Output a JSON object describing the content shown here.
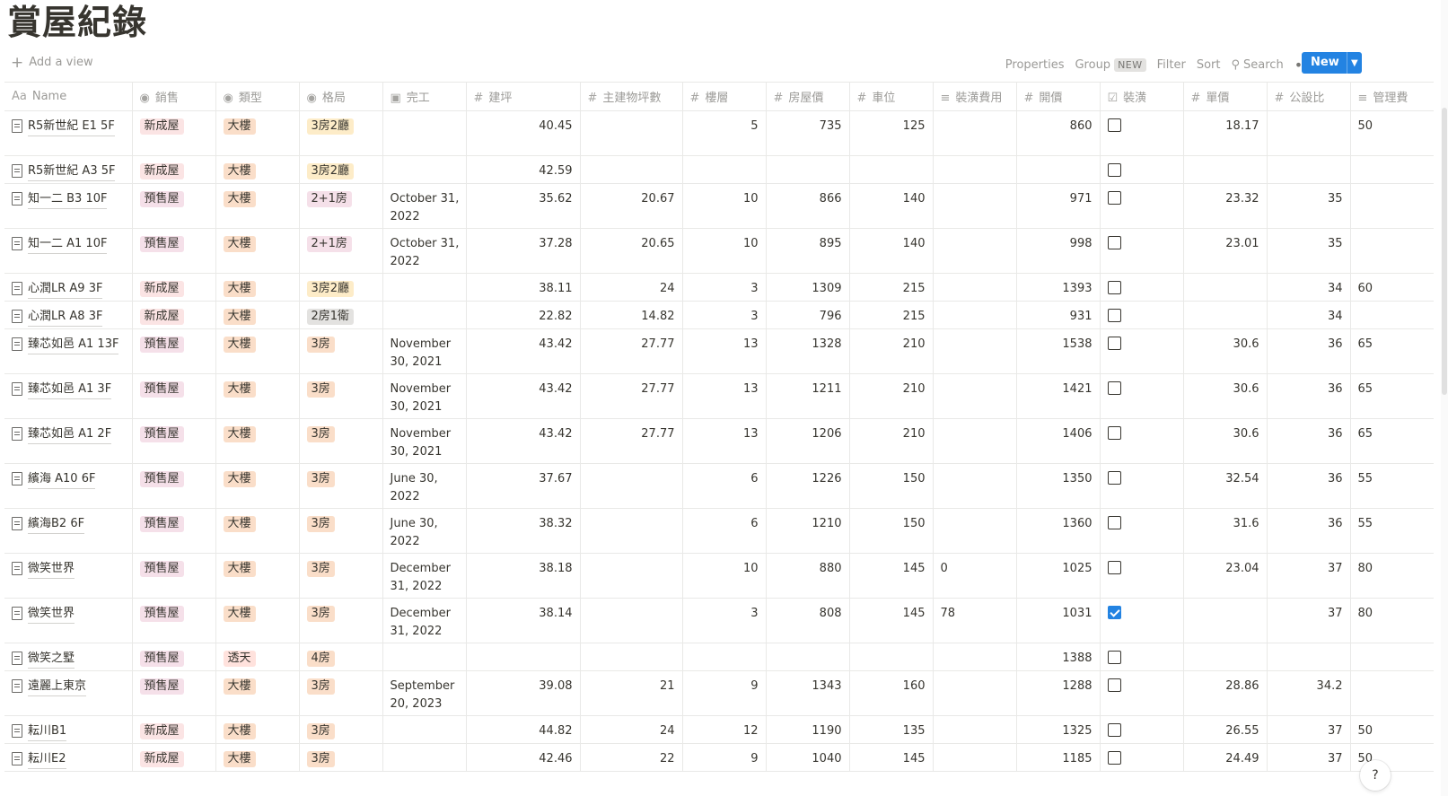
{
  "page": {
    "title": "賞屋紀錄"
  },
  "add_view": {
    "label": "Add a view",
    "icon": "plus-icon"
  },
  "toolbar": {
    "properties": "Properties",
    "group": "Group",
    "group_badge": "NEW",
    "filter": "Filter",
    "sort": "Sort",
    "search": "Search",
    "more": "•••",
    "new_button": "New"
  },
  "columns": [
    {
      "label": "Name",
      "icon": "Aa"
    },
    {
      "label": "銷售",
      "icon": "select-icon"
    },
    {
      "label": "類型",
      "icon": "select-icon"
    },
    {
      "label": "格局",
      "icon": "select-icon"
    },
    {
      "label": "完工",
      "icon": "calendar-icon"
    },
    {
      "label": "建坪",
      "icon": "number-icon"
    },
    {
      "label": "主建物坪數",
      "icon": "number-icon"
    },
    {
      "label": "樓層",
      "icon": "number-icon"
    },
    {
      "label": "房屋價",
      "icon": "number-icon"
    },
    {
      "label": "車位",
      "icon": "number-icon"
    },
    {
      "label": "裝潢費用",
      "icon": "text-icon"
    },
    {
      "label": "開價",
      "icon": "number-icon"
    },
    {
      "label": "裝潢",
      "icon": "checkbox-icon"
    },
    {
      "label": "單價",
      "icon": "number-icon"
    },
    {
      "label": "公設比",
      "icon": "number-icon"
    },
    {
      "label": "管理費",
      "icon": "text-icon"
    }
  ],
  "tag_colors": {
    "新成屋": "#fbe4e4",
    "預售屋": "#f5e0e9",
    "大樓": "#fadec9",
    "透天": "#ffe2dd",
    "3房2廳": "#fdecc8",
    "2+1房": "#f5e0e9",
    "2房1衛": "#e3e2e0",
    "3房": "#fadec9",
    "4房": "#fadec9"
  },
  "rows": [
    {
      "name": "R5新世紀 E1 5F",
      "sale": "新成屋",
      "type": "大樓",
      "layout": "3房2廳",
      "done": "",
      "area": "40.45",
      "main_area": "",
      "floor": "5",
      "house_price": "735",
      "parking": "125",
      "deco_cost": "",
      "ask_price": "860",
      "decorated": false,
      "unit_price": "18.17",
      "public_ratio": "",
      "mgmt_fee": "50",
      "h": 50
    },
    {
      "name": "R5新世紀 A3 5F",
      "sale": "新成屋",
      "type": "大樓",
      "layout": "3房2廳",
      "done": "",
      "area": "42.59",
      "main_area": "",
      "floor": "",
      "house_price": "",
      "parking": "",
      "deco_cost": "",
      "ask_price": "",
      "decorated": false,
      "unit_price": "",
      "public_ratio": "",
      "mgmt_fee": "",
      "h": 31
    },
    {
      "name": "知一二 B3 10F",
      "sale": "預售屋",
      "type": "大樓",
      "layout": "2+1房",
      "done": "October 31, 2022",
      "area": "35.62",
      "main_area": "20.67",
      "floor": "10",
      "house_price": "866",
      "parking": "140",
      "deco_cost": "",
      "ask_price": "971",
      "decorated": false,
      "unit_price": "23.32",
      "public_ratio": "35",
      "mgmt_fee": "",
      "h": 50
    },
    {
      "name": "知一二 A1 10F",
      "sale": "預售屋",
      "type": "大樓",
      "layout": "2+1房",
      "done": "October 31, 2022",
      "area": "37.28",
      "main_area": "20.65",
      "floor": "10",
      "house_price": "895",
      "parking": "140",
      "deco_cost": "",
      "ask_price": "998",
      "decorated": false,
      "unit_price": "23.01",
      "public_ratio": "35",
      "mgmt_fee": "",
      "h": 50
    },
    {
      "name": "心潤LR A9 3F",
      "sale": "新成屋",
      "type": "大樓",
      "layout": "3房2廳",
      "done": "",
      "area": "38.11",
      "main_area": "24",
      "floor": "3",
      "house_price": "1309",
      "parking": "215",
      "deco_cost": "",
      "ask_price": "1393",
      "decorated": false,
      "unit_price": "",
      "public_ratio": "34",
      "mgmt_fee": "60",
      "h": 31
    },
    {
      "name": "心潤LR A8 3F",
      "sale": "新成屋",
      "type": "大樓",
      "layout": "2房1衛",
      "done": "",
      "area": "22.82",
      "main_area": "14.82",
      "floor": "3",
      "house_price": "796",
      "parking": "215",
      "deco_cost": "",
      "ask_price": "931",
      "decorated": false,
      "unit_price": "",
      "public_ratio": "34",
      "mgmt_fee": "",
      "h": 31
    },
    {
      "name": "臻芯如邑 A1 13F",
      "sale": "預售屋",
      "type": "大樓",
      "layout": "3房",
      "done": "November 30, 2021",
      "area": "43.42",
      "main_area": "27.77",
      "floor": "13",
      "house_price": "1328",
      "parking": "210",
      "deco_cost": "",
      "ask_price": "1538",
      "decorated": false,
      "unit_price": "30.6",
      "public_ratio": "36",
      "mgmt_fee": "65",
      "h": 50
    },
    {
      "name": "臻芯如邑 A1 3F",
      "sale": "預售屋",
      "type": "大樓",
      "layout": "3房",
      "done": "November 30, 2021",
      "area": "43.42",
      "main_area": "27.77",
      "floor": "13",
      "house_price": "1211",
      "parking": "210",
      "deco_cost": "",
      "ask_price": "1421",
      "decorated": false,
      "unit_price": "30.6",
      "public_ratio": "36",
      "mgmt_fee": "65",
      "h": 50
    },
    {
      "name": "臻芯如邑 A1 2F",
      "sale": "預售屋",
      "type": "大樓",
      "layout": "3房",
      "done": "November 30, 2021",
      "area": "43.42",
      "main_area": "27.77",
      "floor": "13",
      "house_price": "1206",
      "parking": "210",
      "deco_cost": "",
      "ask_price": "1406",
      "decorated": false,
      "unit_price": "30.6",
      "public_ratio": "36",
      "mgmt_fee": "65",
      "h": 50
    },
    {
      "name": "繽海 A10 6F",
      "sale": "預售屋",
      "type": "大樓",
      "layout": "3房",
      "done": "June 30, 2022",
      "area": "37.67",
      "main_area": "",
      "floor": "6",
      "house_price": "1226",
      "parking": "150",
      "deco_cost": "",
      "ask_price": "1350",
      "decorated": false,
      "unit_price": "32.54",
      "public_ratio": "36",
      "mgmt_fee": "55",
      "h": 50
    },
    {
      "name": "繽海B2 6F",
      "sale": "預售屋",
      "type": "大樓",
      "layout": "3房",
      "done": "June 30, 2022",
      "area": "38.32",
      "main_area": "",
      "floor": "6",
      "house_price": "1210",
      "parking": "150",
      "deco_cost": "",
      "ask_price": "1360",
      "decorated": false,
      "unit_price": "31.6",
      "public_ratio": "36",
      "mgmt_fee": "55",
      "h": 50
    },
    {
      "name": "微笑世界",
      "sale": "預售屋",
      "type": "大樓",
      "layout": "3房",
      "done": "December 31, 2022",
      "area": "38.18",
      "main_area": "",
      "floor": "10",
      "house_price": "880",
      "parking": "145",
      "deco_cost": "0",
      "ask_price": "1025",
      "decorated": false,
      "unit_price": "23.04",
      "public_ratio": "37",
      "mgmt_fee": "80",
      "h": 50
    },
    {
      "name": "微笑世界",
      "sale": "預售屋",
      "type": "大樓",
      "layout": "3房",
      "done": "December 31, 2022",
      "area": "38.14",
      "main_area": "",
      "floor": "3",
      "house_price": "808",
      "parking": "145",
      "deco_cost": "78",
      "ask_price": "1031",
      "decorated": true,
      "unit_price": "",
      "public_ratio": "37",
      "mgmt_fee": "80",
      "h": 50
    },
    {
      "name": "微笑之墅",
      "sale": "預售屋",
      "type": "透天",
      "layout": "4房",
      "done": "",
      "area": "",
      "main_area": "",
      "floor": "",
      "house_price": "",
      "parking": "",
      "deco_cost": "",
      "ask_price": "1388",
      "decorated": false,
      "unit_price": "",
      "public_ratio": "",
      "mgmt_fee": "",
      "h": 31
    },
    {
      "name": "遠麗上東京",
      "sale": "預售屋",
      "type": "大樓",
      "layout": "3房",
      "done": "September 20, 2023",
      "area": "39.08",
      "main_area": "21",
      "floor": "9",
      "house_price": "1343",
      "parking": "160",
      "deco_cost": "",
      "ask_price": "1288",
      "decorated": false,
      "unit_price": "28.86",
      "public_ratio": "34.2",
      "mgmt_fee": "",
      "h": 50
    },
    {
      "name": "耘川B1",
      "sale": "新成屋",
      "type": "大樓",
      "layout": "3房",
      "done": "",
      "area": "44.82",
      "main_area": "24",
      "floor": "12",
      "house_price": "1190",
      "parking": "135",
      "deco_cost": "",
      "ask_price": "1325",
      "decorated": false,
      "unit_price": "26.55",
      "public_ratio": "37",
      "mgmt_fee": "50",
      "h": 31
    },
    {
      "name": "耘川E2",
      "sale": "新成屋",
      "type": "大樓",
      "layout": "3房",
      "done": "",
      "area": "42.46",
      "main_area": "22",
      "floor": "9",
      "house_price": "1040",
      "parking": "145",
      "deco_cost": "",
      "ask_price": "1185",
      "decorated": false,
      "unit_price": "24.49",
      "public_ratio": "37",
      "mgmt_fee": "50",
      "h": 31
    }
  ],
  "help_button": "?"
}
